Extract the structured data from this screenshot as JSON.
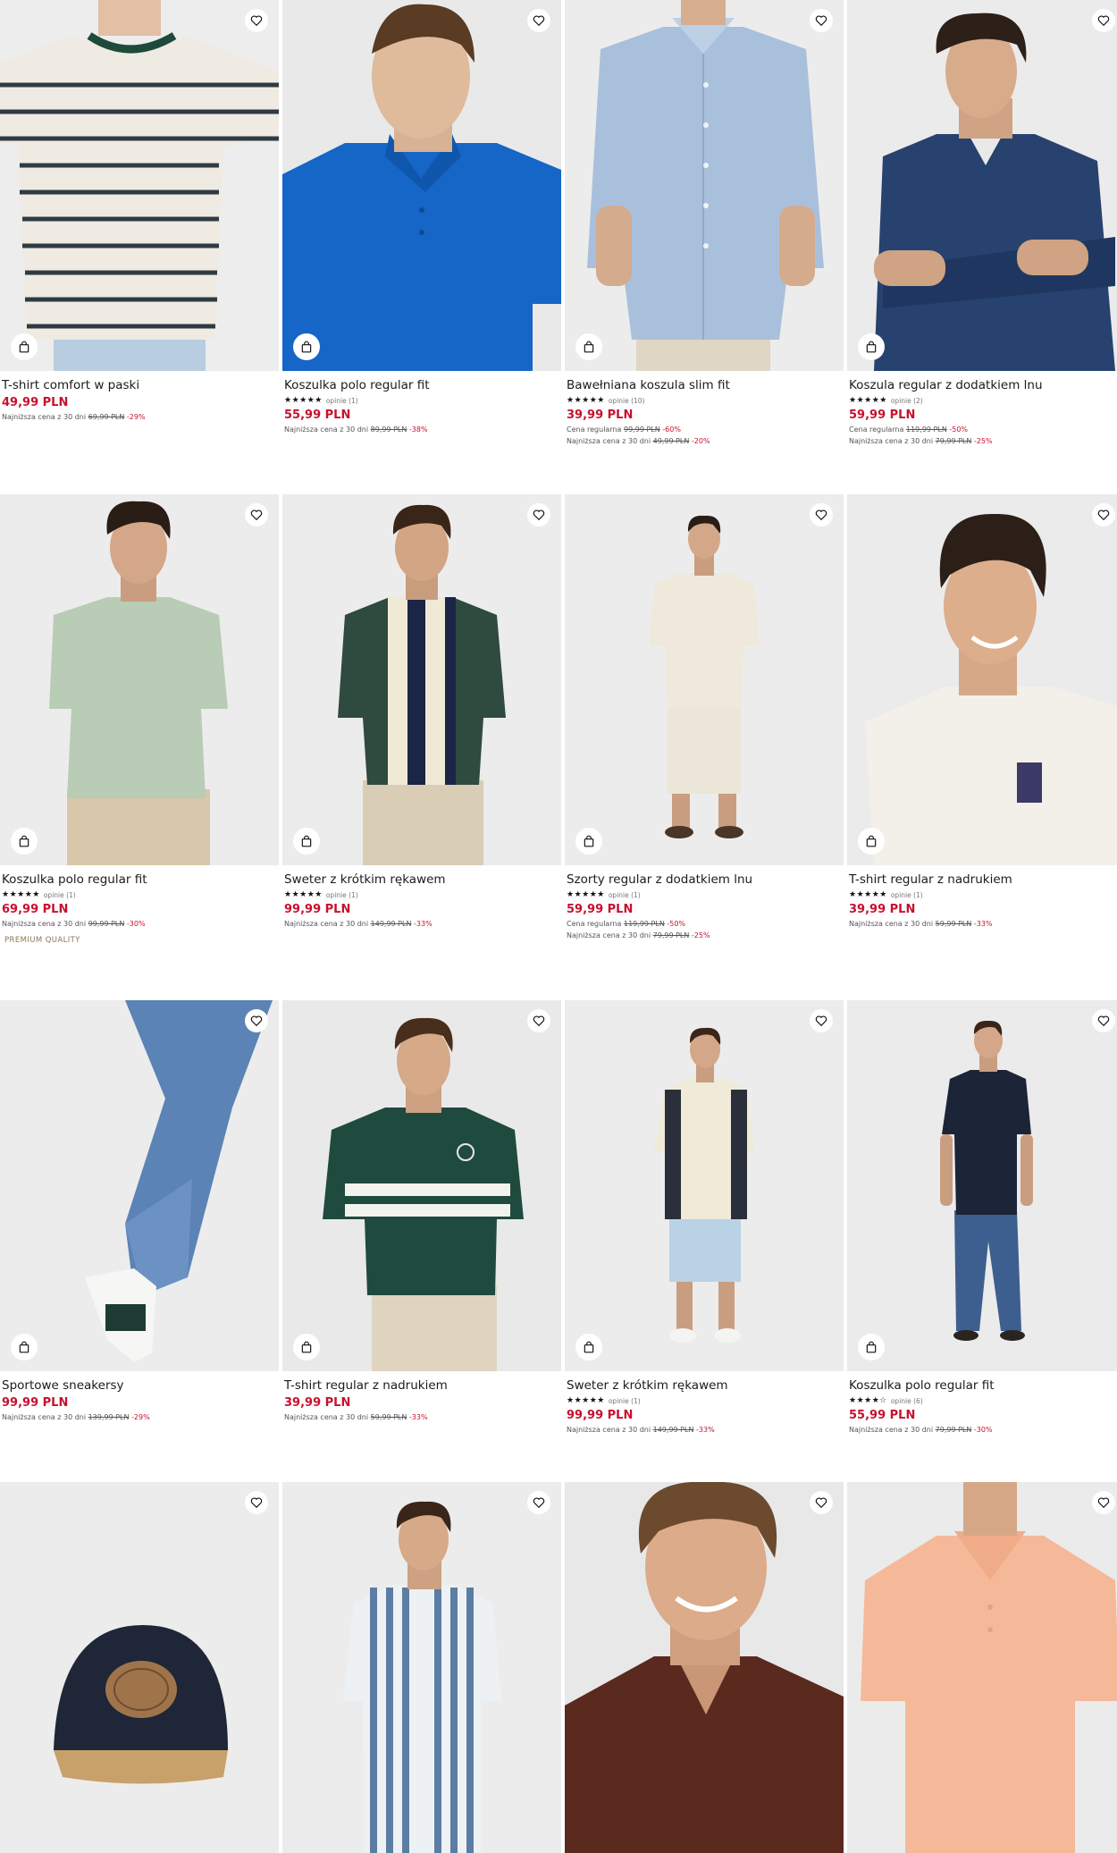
{
  "icons": {
    "favorite": "heart-icon",
    "cart": "shopping-bag-icon"
  },
  "colors": {
    "price": "#c8102e",
    "image_bg": "#ececec",
    "badge": "#8a7a55"
  },
  "products": [
    {
      "name": "T-shirt comfort w paski",
      "price": "49,99 PLN",
      "lowest_label": "Najniższa cena z 30 dni",
      "lowest_old": "69,99 PLN",
      "lowest_pct": "-29%"
    },
    {
      "name": "Koszulka polo regular fit",
      "stars": "★★★★★",
      "reviews": "opinie (1)",
      "price": "55,99 PLN",
      "lowest_label": "Najniższa cena z 30 dni",
      "lowest_old": "89,99 PLN",
      "lowest_pct": "-38%"
    },
    {
      "name": "Bawełniana koszula slim fit",
      "stars": "★★★★★",
      "reviews": "opinie (10)",
      "price": "39,99 PLN",
      "regular_label": "Cena regularna",
      "regular_old": "99,99 PLN",
      "regular_pct": "-60%",
      "lowest_label": "Najniższa cena z 30 dni",
      "lowest_old": "49,99 PLN",
      "lowest_pct": "-20%"
    },
    {
      "name": "Koszula regular z dodatkiem lnu",
      "stars": "★★★★★",
      "reviews": "opinie (2)",
      "price": "59,99 PLN",
      "regular_label": "Cena regularna",
      "regular_old": "119,99 PLN",
      "regular_pct": "-50%",
      "lowest_label": "Najniższa cena z 30 dni",
      "lowest_old": "79,99 PLN",
      "lowest_pct": "-25%"
    },
    {
      "name": "Koszulka polo regular fit",
      "stars": "★★★★★",
      "reviews": "opinie (1)",
      "price": "69,99 PLN",
      "lowest_label": "Najniższa cena z 30 dni",
      "lowest_old": "99,99 PLN",
      "lowest_pct": "-30%",
      "badge": "PREMIUM QUALITY"
    },
    {
      "name": "Sweter z krótkim rękawem",
      "stars": "★★★★★",
      "reviews": "opinie (1)",
      "price": "99,99 PLN",
      "lowest_label": "Najniższa cena z 30 dni",
      "lowest_old": "149,99 PLN",
      "lowest_pct": "-33%"
    },
    {
      "name": "Szorty regular z dodatkiem lnu",
      "stars": "★★★★★",
      "reviews": "opinie (1)",
      "price": "59,99 PLN",
      "regular_label": "Cena regularna",
      "regular_old": "119,99 PLN",
      "regular_pct": "-50%",
      "lowest_label": "Najniższa cena z 30 dni",
      "lowest_old": "79,99 PLN",
      "lowest_pct": "-25%"
    },
    {
      "name": "T-shirt regular z nadrukiem",
      "stars": "★★★★★",
      "reviews": "opinie (1)",
      "price": "39,99 PLN",
      "lowest_label": "Najniższa cena z 30 dni",
      "lowest_old": "59,99 PLN",
      "lowest_pct": "-33%"
    },
    {
      "name": "Sportowe sneakersy",
      "price": "99,99 PLN",
      "lowest_label": "Najniższa cena z 30 dni",
      "lowest_old": "139,99 PLN",
      "lowest_pct": "-29%"
    },
    {
      "name": "T-shirt regular z nadrukiem",
      "price": "39,99 PLN",
      "lowest_label": "Najniższa cena z 30 dni",
      "lowest_old": "59,99 PLN",
      "lowest_pct": "-33%"
    },
    {
      "name": "Sweter z krótkim rękawem",
      "stars": "★★★★★",
      "reviews": "opinie (1)",
      "price": "99,99 PLN",
      "lowest_label": "Najniższa cena z 30 dni",
      "lowest_old": "149,99 PLN",
      "lowest_pct": "-33%"
    },
    {
      "name": "Koszulka polo regular fit",
      "stars": "★★★★☆",
      "reviews": "opinie (6)",
      "price": "55,99 PLN",
      "lowest_label": "Najniższa cena z 30 dni",
      "lowest_old": "79,99 PLN",
      "lowest_pct": "-30%"
    },
    {},
    {},
    {},
    {}
  ]
}
